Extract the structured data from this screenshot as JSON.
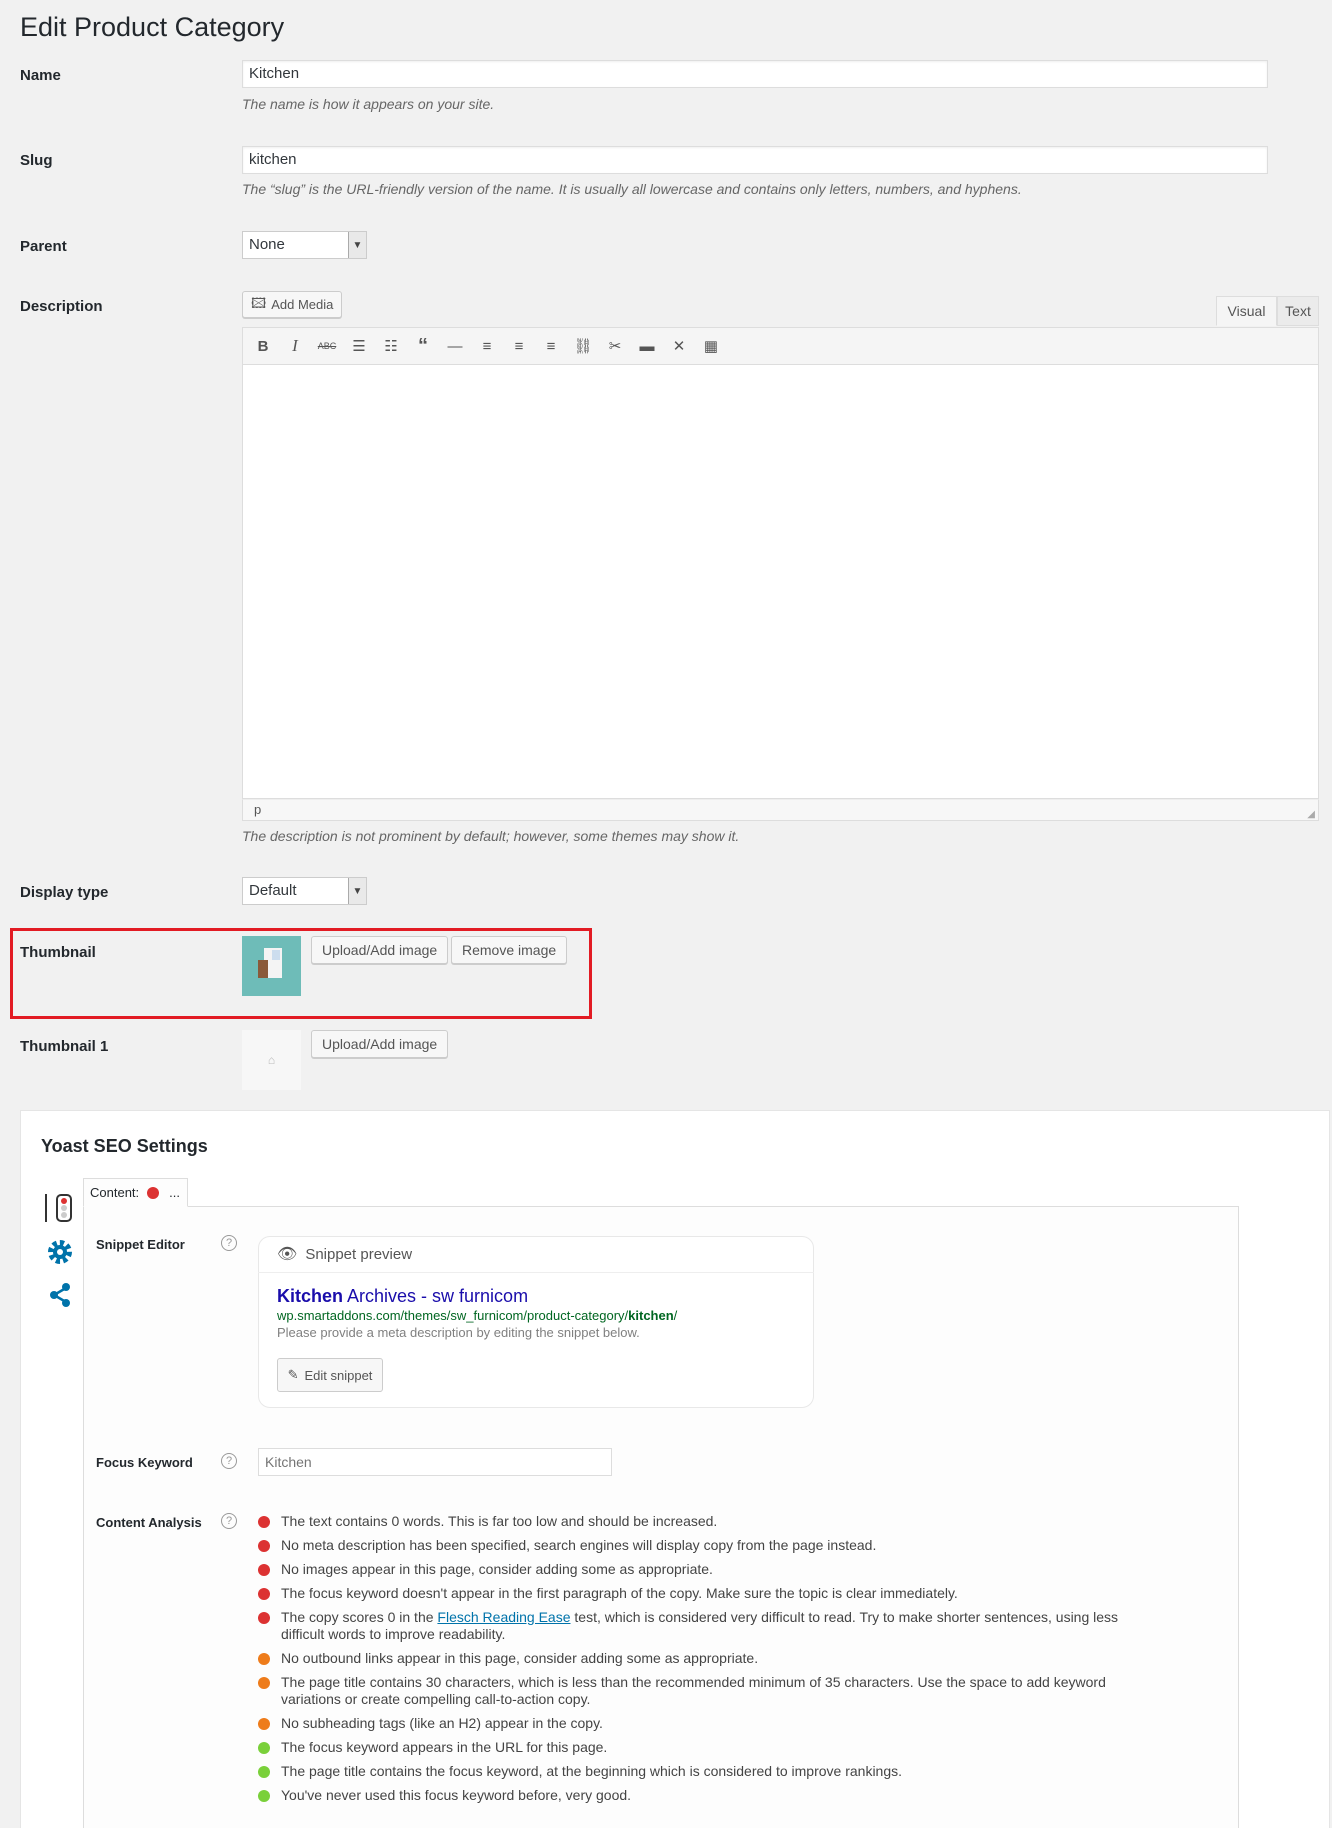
{
  "page": {
    "title": "Edit Product Category"
  },
  "fields": {
    "name": {
      "label": "Name",
      "value": "Kitchen",
      "hint": "The name is how it appears on your site."
    },
    "slug": {
      "label": "Slug",
      "value": "kitchen",
      "hint": "The “slug” is the URL-friendly version of the name. It is usually all lowercase and contains only letters, numbers, and hyphens."
    },
    "parent": {
      "label": "Parent",
      "value": "None"
    },
    "description": {
      "label": "Description",
      "add_media": "Add Media",
      "tab_visual": "Visual",
      "tab_text": "Text",
      "status_path": "p",
      "hint": "The description is not prominent by default; however, some themes may show it.",
      "toolbar": [
        "bold-icon",
        "italic-icon",
        "strikethrough-icon",
        "bullet-list-icon",
        "numbered-list-icon",
        "blockquote-icon",
        "horizontal-rule-icon",
        "align-left-icon",
        "align-center-icon",
        "align-right-icon",
        "link-icon",
        "unlink-icon",
        "read-more-icon",
        "fullscreen-icon",
        "toolbar-toggle-icon"
      ]
    },
    "display_type": {
      "label": "Display type",
      "value": "Default"
    },
    "thumbnail": {
      "label": "Thumbnail",
      "upload": "Upload/Add image",
      "remove": "Remove image"
    },
    "thumbnail1": {
      "label": "Thumbnail 1",
      "upload": "Upload/Add image"
    }
  },
  "yoast": {
    "title": "Yoast SEO Settings",
    "tab_label": "Content:",
    "tab_more": "...",
    "snippet_editor_label": "Snippet Editor",
    "snippet_preview_label": "Snippet preview",
    "snippet_title_keyword": "Kitchen",
    "snippet_title_rest": " Archives - sw furnicom",
    "snippet_url_base": "wp.smartaddons.com/themes/sw_furnicom/product-category/",
    "snippet_url_keyword": "kitchen",
    "snippet_url_end": "/",
    "snippet_desc": "Please provide a meta description by editing the snippet below.",
    "edit_snippet": "Edit snippet",
    "focus_keyword_label": "Focus Keyword",
    "focus_keyword_placeholder": "Kitchen",
    "content_analysis_label": "Content Analysis",
    "help": "?",
    "colors": {
      "bad": "#dc3232",
      "ok": "#ee7c1b",
      "good": "#7ad03a"
    },
    "analysis": [
      {
        "status": "bad",
        "text": "The text contains 0 words. This is far too low and should be increased."
      },
      {
        "status": "bad",
        "text": "No meta description has been specified, search engines will display copy from the page instead."
      },
      {
        "status": "bad",
        "text": "No images appear in this page, consider adding some as appropriate."
      },
      {
        "status": "bad",
        "text": "The focus keyword doesn't appear in the first paragraph of the copy. Make sure the topic is clear immediately."
      },
      {
        "status": "bad",
        "text_before": "The copy scores 0 in the ",
        "link": "Flesch Reading Ease",
        "text_after": " test, which is considered very difficult to read. Try to make shorter sentences, using less difficult words to improve readability."
      },
      {
        "status": "ok",
        "text": "No outbound links appear in this page, consider adding some as appropriate."
      },
      {
        "status": "ok",
        "text": "The page title contains 30 characters, which is less than the recommended minimum of 35 characters. Use the space to add keyword variations or create compelling call-to-action copy."
      },
      {
        "status": "ok",
        "text": "No subheading tags (like an H2) appear in the copy."
      },
      {
        "status": "good",
        "text": "The focus keyword appears in the URL for this page."
      },
      {
        "status": "good",
        "text": "The page title contains the focus keyword, at the beginning which is considered to improve rankings."
      },
      {
        "status": "good",
        "text": "You've never used this focus keyword before, very good."
      }
    ]
  }
}
